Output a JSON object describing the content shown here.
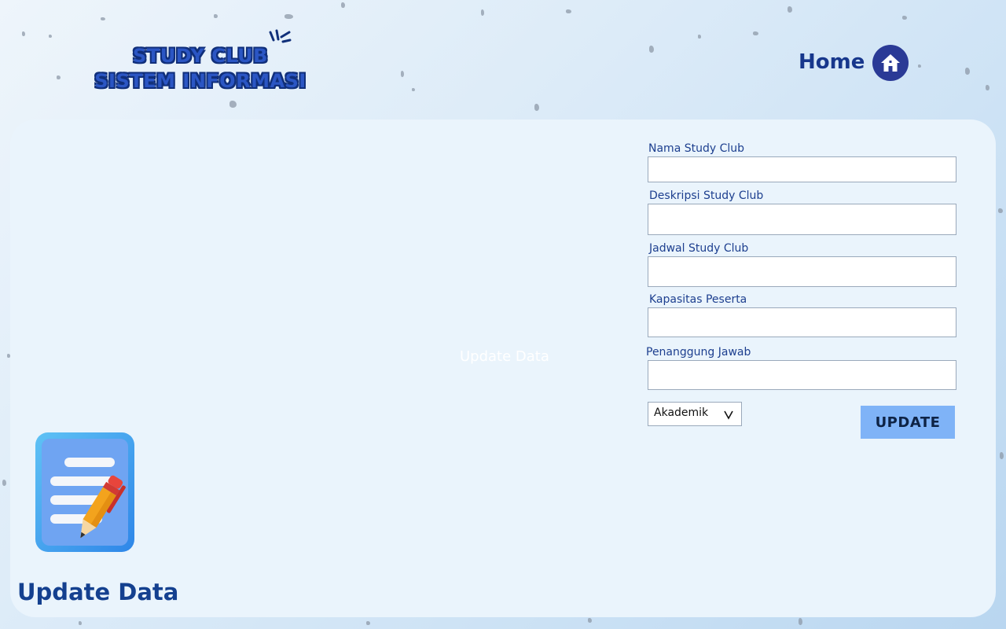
{
  "header": {
    "logo_line1": "STUDY CLUB",
    "logo_line2": "SISTEM INFORMASI",
    "home_label": "Home",
    "home_icon": "house-icon"
  },
  "main": {
    "ghost_title": "Update Data",
    "page_heading": "Update Data",
    "illustration_icon": "clipboard-pencil-icon"
  },
  "form": {
    "fields": [
      {
        "label": "Nama Study Club",
        "value": ""
      },
      {
        "label": "Deskripsi Study Club",
        "value": ""
      },
      {
        "label": "Jadwal Study Club",
        "value": ""
      },
      {
        "label": "Kapasitas Peserta",
        "value": ""
      },
      {
        "label": "Penanggung Jawab",
        "value": ""
      }
    ],
    "category_select": {
      "selected": "Akademik",
      "icon": "chevron-down-icon"
    },
    "update_label": "UPDATE"
  },
  "colors": {
    "brand_dark": "#17378c",
    "panel": "#eaf4fc",
    "button": "#7fb3f7",
    "home_circle": "#2a3a96"
  }
}
